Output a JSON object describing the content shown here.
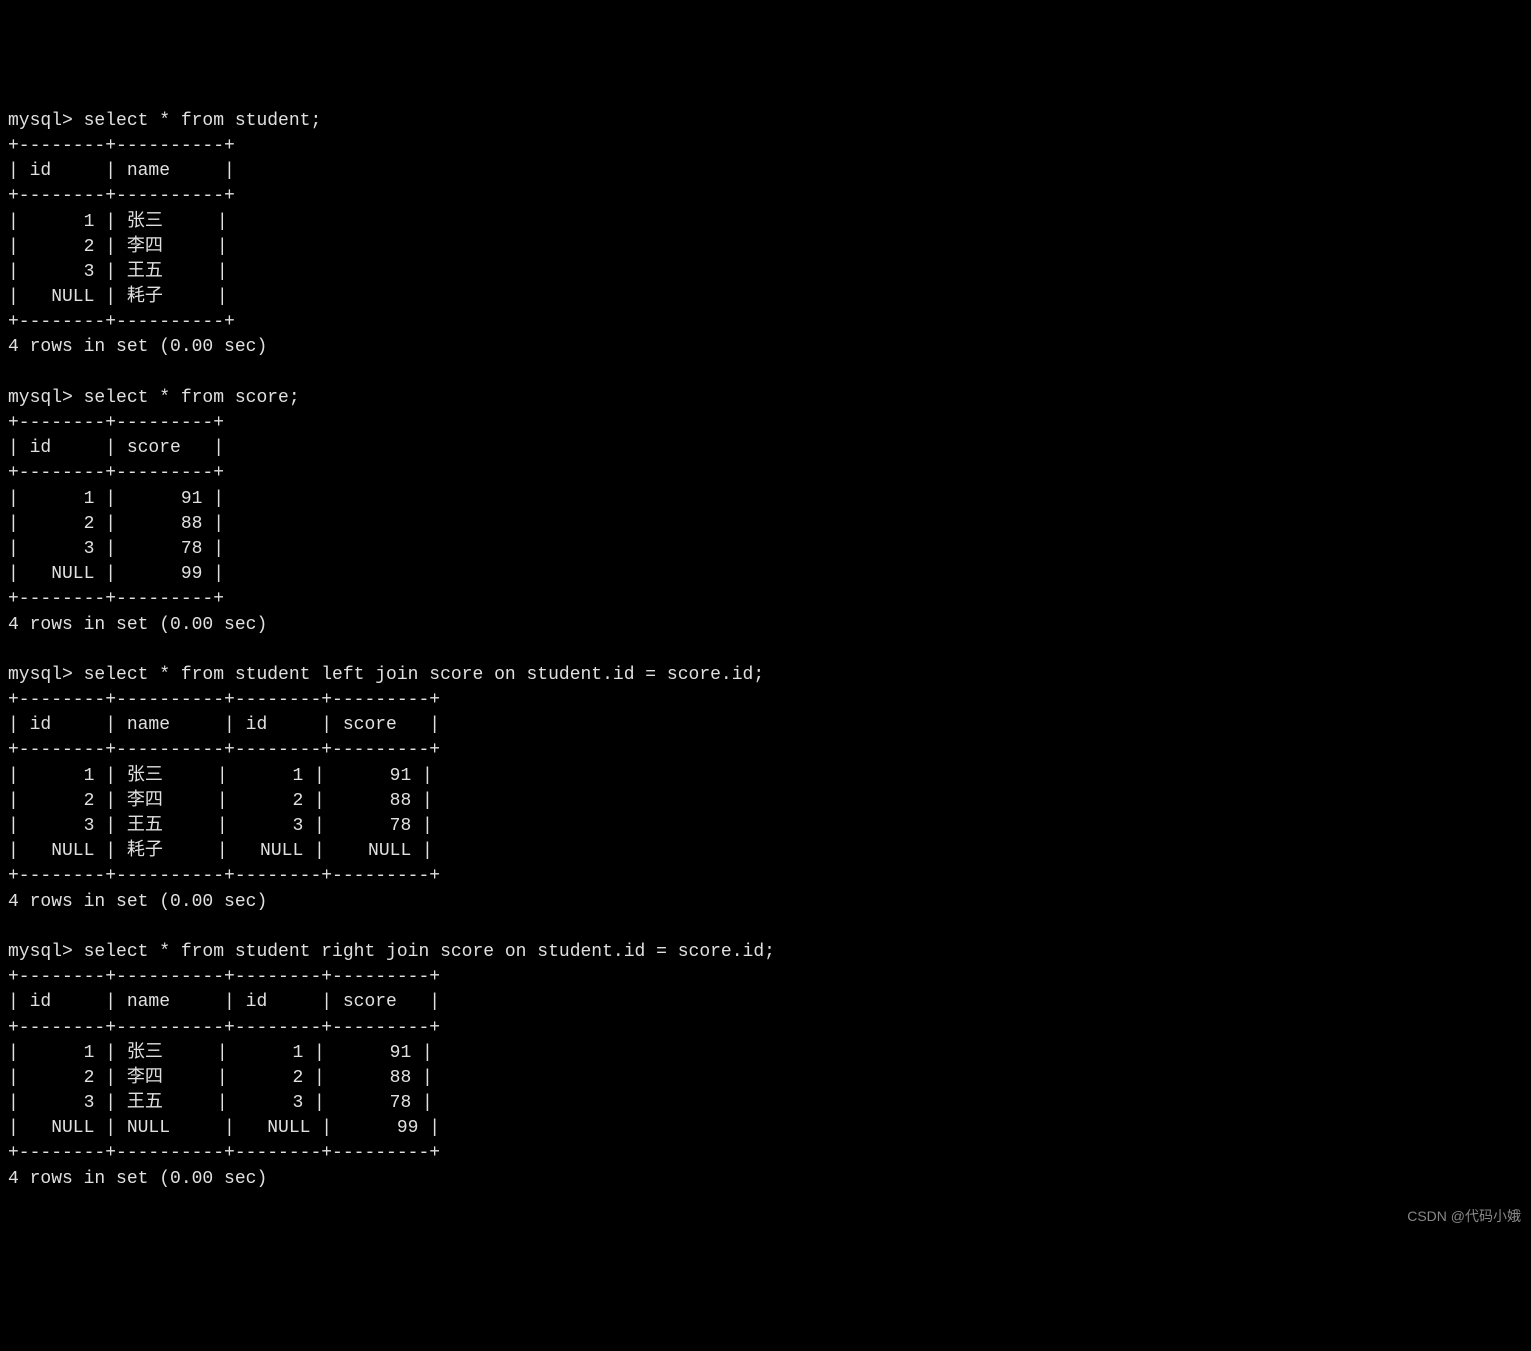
{
  "prompt": "mysql> ",
  "queries": [
    {
      "sql": "select * from student;",
      "columns": [
        "id",
        "name"
      ],
      "widths": [
        6,
        8
      ],
      "rows": [
        [
          "1",
          "张三"
        ],
        [
          "2",
          "李四"
        ],
        [
          "3",
          "王五"
        ],
        [
          "NULL",
          "耗子"
        ]
      ],
      "footer": "4 rows in set (0.00 sec)"
    },
    {
      "sql": "select * from score;",
      "columns": [
        "id",
        "score"
      ],
      "widths": [
        6,
        7
      ],
      "rows": [
        [
          "1",
          "91"
        ],
        [
          "2",
          "88"
        ],
        [
          "3",
          "78"
        ],
        [
          "NULL",
          "99"
        ]
      ],
      "footer": "4 rows in set (0.00 sec)"
    },
    {
      "sql": "select * from student left join score on student.id = score.id;",
      "columns": [
        "id",
        "name",
        "id",
        "score"
      ],
      "widths": [
        6,
        8,
        6,
        7
      ],
      "rows": [
        [
          "1",
          "张三",
          "1",
          "91"
        ],
        [
          "2",
          "李四",
          "2",
          "88"
        ],
        [
          "3",
          "王五",
          "3",
          "78"
        ],
        [
          "NULL",
          "耗子",
          "NULL",
          "NULL"
        ]
      ],
      "footer": "4 rows in set (0.00 sec)"
    },
    {
      "sql": "select * from student right join score on student.id = score.id;",
      "columns": [
        "id",
        "name",
        "id",
        "score"
      ],
      "widths": [
        6,
        8,
        6,
        7
      ],
      "rows": [
        [
          "1",
          "张三",
          "1",
          "91"
        ],
        [
          "2",
          "李四",
          "2",
          "88"
        ],
        [
          "3",
          "王五",
          "3",
          "78"
        ],
        [
          "NULL",
          "NULL",
          "NULL",
          "99"
        ]
      ],
      "footer": "4 rows in set (0.00 sec)"
    }
  ],
  "watermark": "CSDN @代码小娥"
}
